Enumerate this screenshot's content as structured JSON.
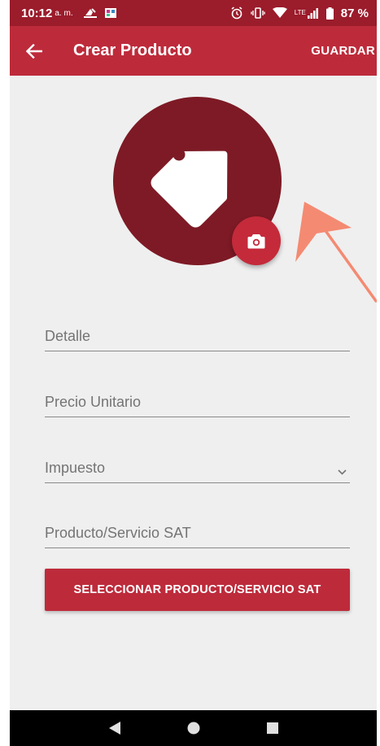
{
  "status_bar": {
    "time": "10:12",
    "ampm": "a. m.",
    "battery": "87 %",
    "network": "LTE"
  },
  "app_bar": {
    "title": "Crear Producto",
    "save_label": "GUARDAR"
  },
  "form": {
    "detalle_placeholder": "Detalle",
    "precio_placeholder": "Precio Unitario",
    "impuesto_placeholder": "Impuesto",
    "sat_placeholder": "Producto/Servicio SAT",
    "select_sat_label": "SELECCIONAR PRODUCTO/SERVICIO SAT"
  },
  "icons": {
    "back": "arrow-left-icon",
    "tag": "tag-icon",
    "camera": "camera-icon",
    "dropdown": "chevron-down-icon"
  },
  "colors": {
    "status_bar": "#9b1c2b",
    "app_bar": "#bd2b3b",
    "avatar": "#7d1a25",
    "camera_button": "#c42a3a",
    "arrow": "#f48a72",
    "background": "#efefef"
  }
}
